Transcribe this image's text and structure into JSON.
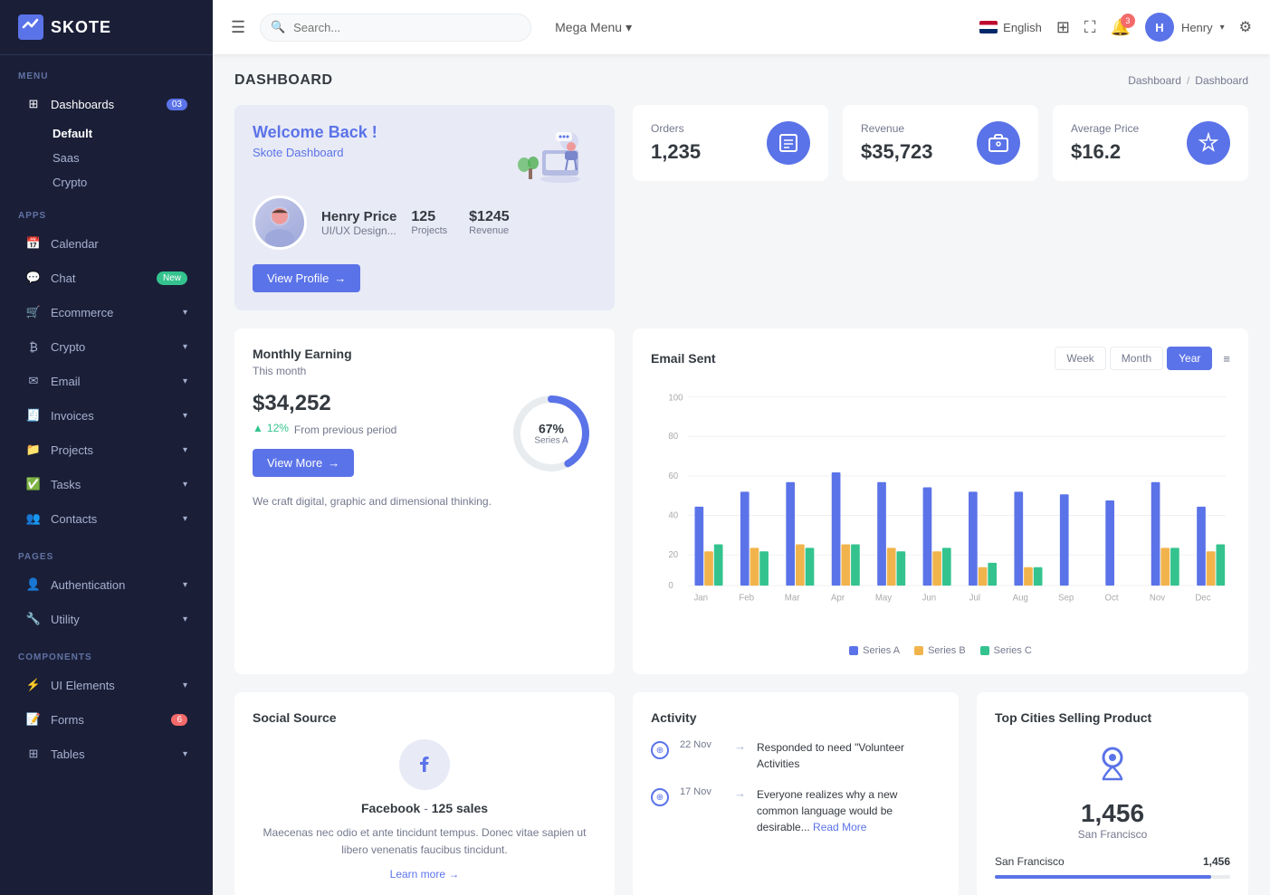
{
  "app": {
    "name": "SKOTE"
  },
  "sidebar": {
    "menu_label": "MENU",
    "apps_label": "APPS",
    "pages_label": "PAGES",
    "components_label": "COMPONENTS",
    "dashboards": {
      "label": "Dashboards",
      "badge": "03",
      "items": [
        "Default",
        "Saas",
        "Crypto"
      ]
    },
    "apps": [
      {
        "label": "Calendar",
        "icon": "calendar"
      },
      {
        "label": "Chat",
        "icon": "chat",
        "badge": "New",
        "badge_type": "green"
      },
      {
        "label": "Ecommerce",
        "icon": "ecommerce",
        "has_arrow": true
      },
      {
        "label": "Crypto",
        "icon": "crypto",
        "has_arrow": true
      },
      {
        "label": "Email",
        "icon": "email",
        "has_arrow": true
      },
      {
        "label": "Invoices",
        "icon": "invoices",
        "has_arrow": true
      },
      {
        "label": "Projects",
        "icon": "projects",
        "has_arrow": true
      },
      {
        "label": "Tasks",
        "icon": "tasks",
        "has_arrow": true
      },
      {
        "label": "Contacts",
        "icon": "contacts",
        "has_arrow": true
      }
    ],
    "pages": [
      {
        "label": "Authentication",
        "icon": "auth",
        "has_arrow": true
      },
      {
        "label": "Utility",
        "icon": "utility",
        "has_arrow": true
      }
    ],
    "components": [
      {
        "label": "UI Elements",
        "icon": "ui",
        "has_arrow": true
      },
      {
        "label": "Forms",
        "icon": "forms",
        "badge": "6",
        "badge_type": "red"
      },
      {
        "label": "Tables",
        "icon": "tables",
        "has_arrow": true
      }
    ]
  },
  "header": {
    "search_placeholder": "Search...",
    "mega_menu_label": "Mega Menu",
    "language": "English",
    "notifications_count": "3",
    "user_name": "Henry"
  },
  "breadcrumb": {
    "parent": "Dashboard",
    "current": "Dashboard"
  },
  "page_title": "DASHBOARD",
  "welcome_card": {
    "title": "Welcome Back !",
    "subtitle": "Skote Dashboard",
    "user_name": "Henry Price",
    "user_role": "UI/UX Design...",
    "projects_count": "125",
    "projects_label": "Projects",
    "revenue_amount": "$1245",
    "revenue_label": "Revenue",
    "view_profile_label": "View Profile"
  },
  "stats": [
    {
      "label": "Orders",
      "value": "1,235",
      "icon": "📋",
      "icon_bg": "blue"
    },
    {
      "label": "Revenue",
      "value": "$35,723",
      "icon": "💼",
      "icon_bg": "blue"
    },
    {
      "label": "Average Price",
      "value": "$16.2",
      "icon": "🏷️",
      "icon_bg": "blue"
    }
  ],
  "monthly_earning": {
    "title": "Monthly Earning",
    "period": "This month",
    "amount": "$34,252",
    "change_pct": "12%",
    "change_label": "From previous period",
    "donut_pct": "67%",
    "donut_series": "Series A",
    "view_more_label": "View More",
    "description": "We craft digital, graphic and dimensional thinking."
  },
  "email_sent": {
    "title": "Email Sent",
    "tabs": [
      "Week",
      "Month",
      "Year"
    ],
    "active_tab": "Year",
    "series": [
      {
        "name": "Series A",
        "color": "#5b73e8"
      },
      {
        "name": "Series B",
        "color": "#f1b44c"
      },
      {
        "name": "Series C",
        "color": "#34c38f"
      }
    ],
    "months": [
      "Jan",
      "Feb",
      "Mar",
      "Apr",
      "May",
      "Jun",
      "Jul",
      "Aug",
      "Sep",
      "Oct",
      "Nov",
      "Dec"
    ],
    "y_labels": [
      "0",
      "20",
      "40",
      "60",
      "80",
      "100"
    ],
    "bars": [
      {
        "a": 42,
        "b": 18,
        "c": 22
      },
      {
        "a": 50,
        "b": 20,
        "c": 18
      },
      {
        "a": 55,
        "b": 22,
        "c": 20
      },
      {
        "a": 60,
        "b": 22,
        "c": 22
      },
      {
        "a": 55,
        "b": 20,
        "c": 18
      },
      {
        "a": 52,
        "b": 18,
        "c": 20
      },
      {
        "a": 50,
        "b": 10,
        "c": 12
      },
      {
        "a": 50,
        "b": 10,
        "c": 10
      },
      {
        "a": 48,
        "b": 0,
        "c": 0
      },
      {
        "a": 45,
        "b": 0,
        "c": 0
      },
      {
        "a": 55,
        "b": 20,
        "c": 20
      },
      {
        "a": 42,
        "b": 18,
        "c": 28
      }
    ]
  },
  "social_source": {
    "title": "Social Source",
    "platform": "Facebook",
    "sales": "125 sales",
    "description": "Maecenas nec odio et ante tincidunt tempus. Donec vitae sapien ut libero venenatis faucibus tincidunt.",
    "learn_more_label": "Learn more"
  },
  "activity": {
    "title": "Activity",
    "items": [
      {
        "date": "22 Nov",
        "text": "Responded to need \"Volunteer Activities"
      },
      {
        "date": "17 Nov",
        "text": "Everyone realizes why a new common language would be desirable...Read More"
      }
    ]
  },
  "top_cities": {
    "title": "Top Cities Selling Product",
    "main_count": "1,456",
    "main_city": "San Francisco",
    "cities": [
      {
        "name": "San Francisco",
        "value": "1,456",
        "pct": 92
      }
    ]
  }
}
